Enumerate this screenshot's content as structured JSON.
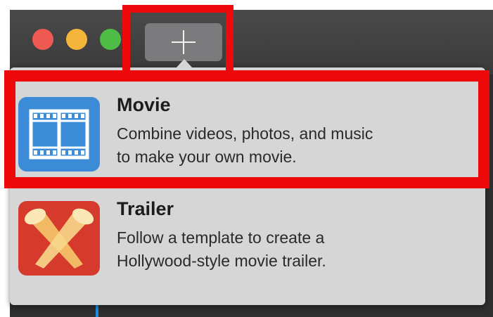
{
  "toolbar": {
    "add_button_icon": "plus-icon"
  },
  "menu": {
    "items": [
      {
        "title": "Movie",
        "description_line1": "Combine videos, photos, and music",
        "description_line2": "to make your own movie.",
        "icon": "film-strip-icon",
        "icon_color": "#3c8bd6"
      },
      {
        "title": "Trailer",
        "description_line1": "Follow a template to create a",
        "description_line2": "Hollywood-style movie trailer.",
        "icon": "spotlights-icon",
        "icon_color": "#d63a2d"
      }
    ]
  },
  "colors": {
    "highlight": "#ee0a0a",
    "window_bg": "#2f2f30",
    "popover_bg": "#d6d6d6",
    "traffic_close": "#ee5a52",
    "traffic_minimize": "#f5b53a",
    "traffic_zoom": "#4fbd45"
  }
}
